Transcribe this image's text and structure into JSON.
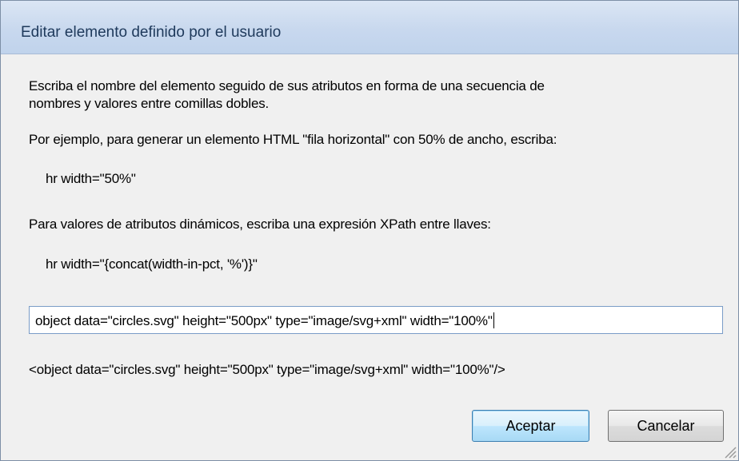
{
  "dialog": {
    "title": "Editar elemento definido por el usuario",
    "instructions_line1": "Escriba el nombre del elemento seguido de sus atributos en forma de una secuencia de",
    "instructions_line2": "nombres y valores entre comillas dobles.",
    "example_intro": "Por ejemplo, para generar un elemento HTML \"fila horizontal\" con 50% de ancho, escriba:",
    "example_code": "hr width=\"50%\"",
    "dynamic_intro": "Para valores de atributos dinámicos, escriba una expresión XPath entre llaves:",
    "dynamic_code": "hr width=\"{concat(width-in-pct, '%')}\"",
    "input_value": "object data=\"circles.svg\" height=\"500px\" type=\"image/svg+xml\" width=\"100%\"",
    "preview": "<object data=\"circles.svg\" height=\"500px\" type=\"image/svg+xml\" width=\"100%\"/>",
    "ok_label": "Aceptar",
    "cancel_label": "Cancelar"
  },
  "icons": {
    "resize_grip": "resize-grip-icon"
  },
  "colors": {
    "title_bar": "#c8d8ee",
    "title_text": "#1e395b",
    "dialog_bg": "#f0f0f0",
    "input_border": "#7a9cc7",
    "default_button": "#bee6fd"
  }
}
